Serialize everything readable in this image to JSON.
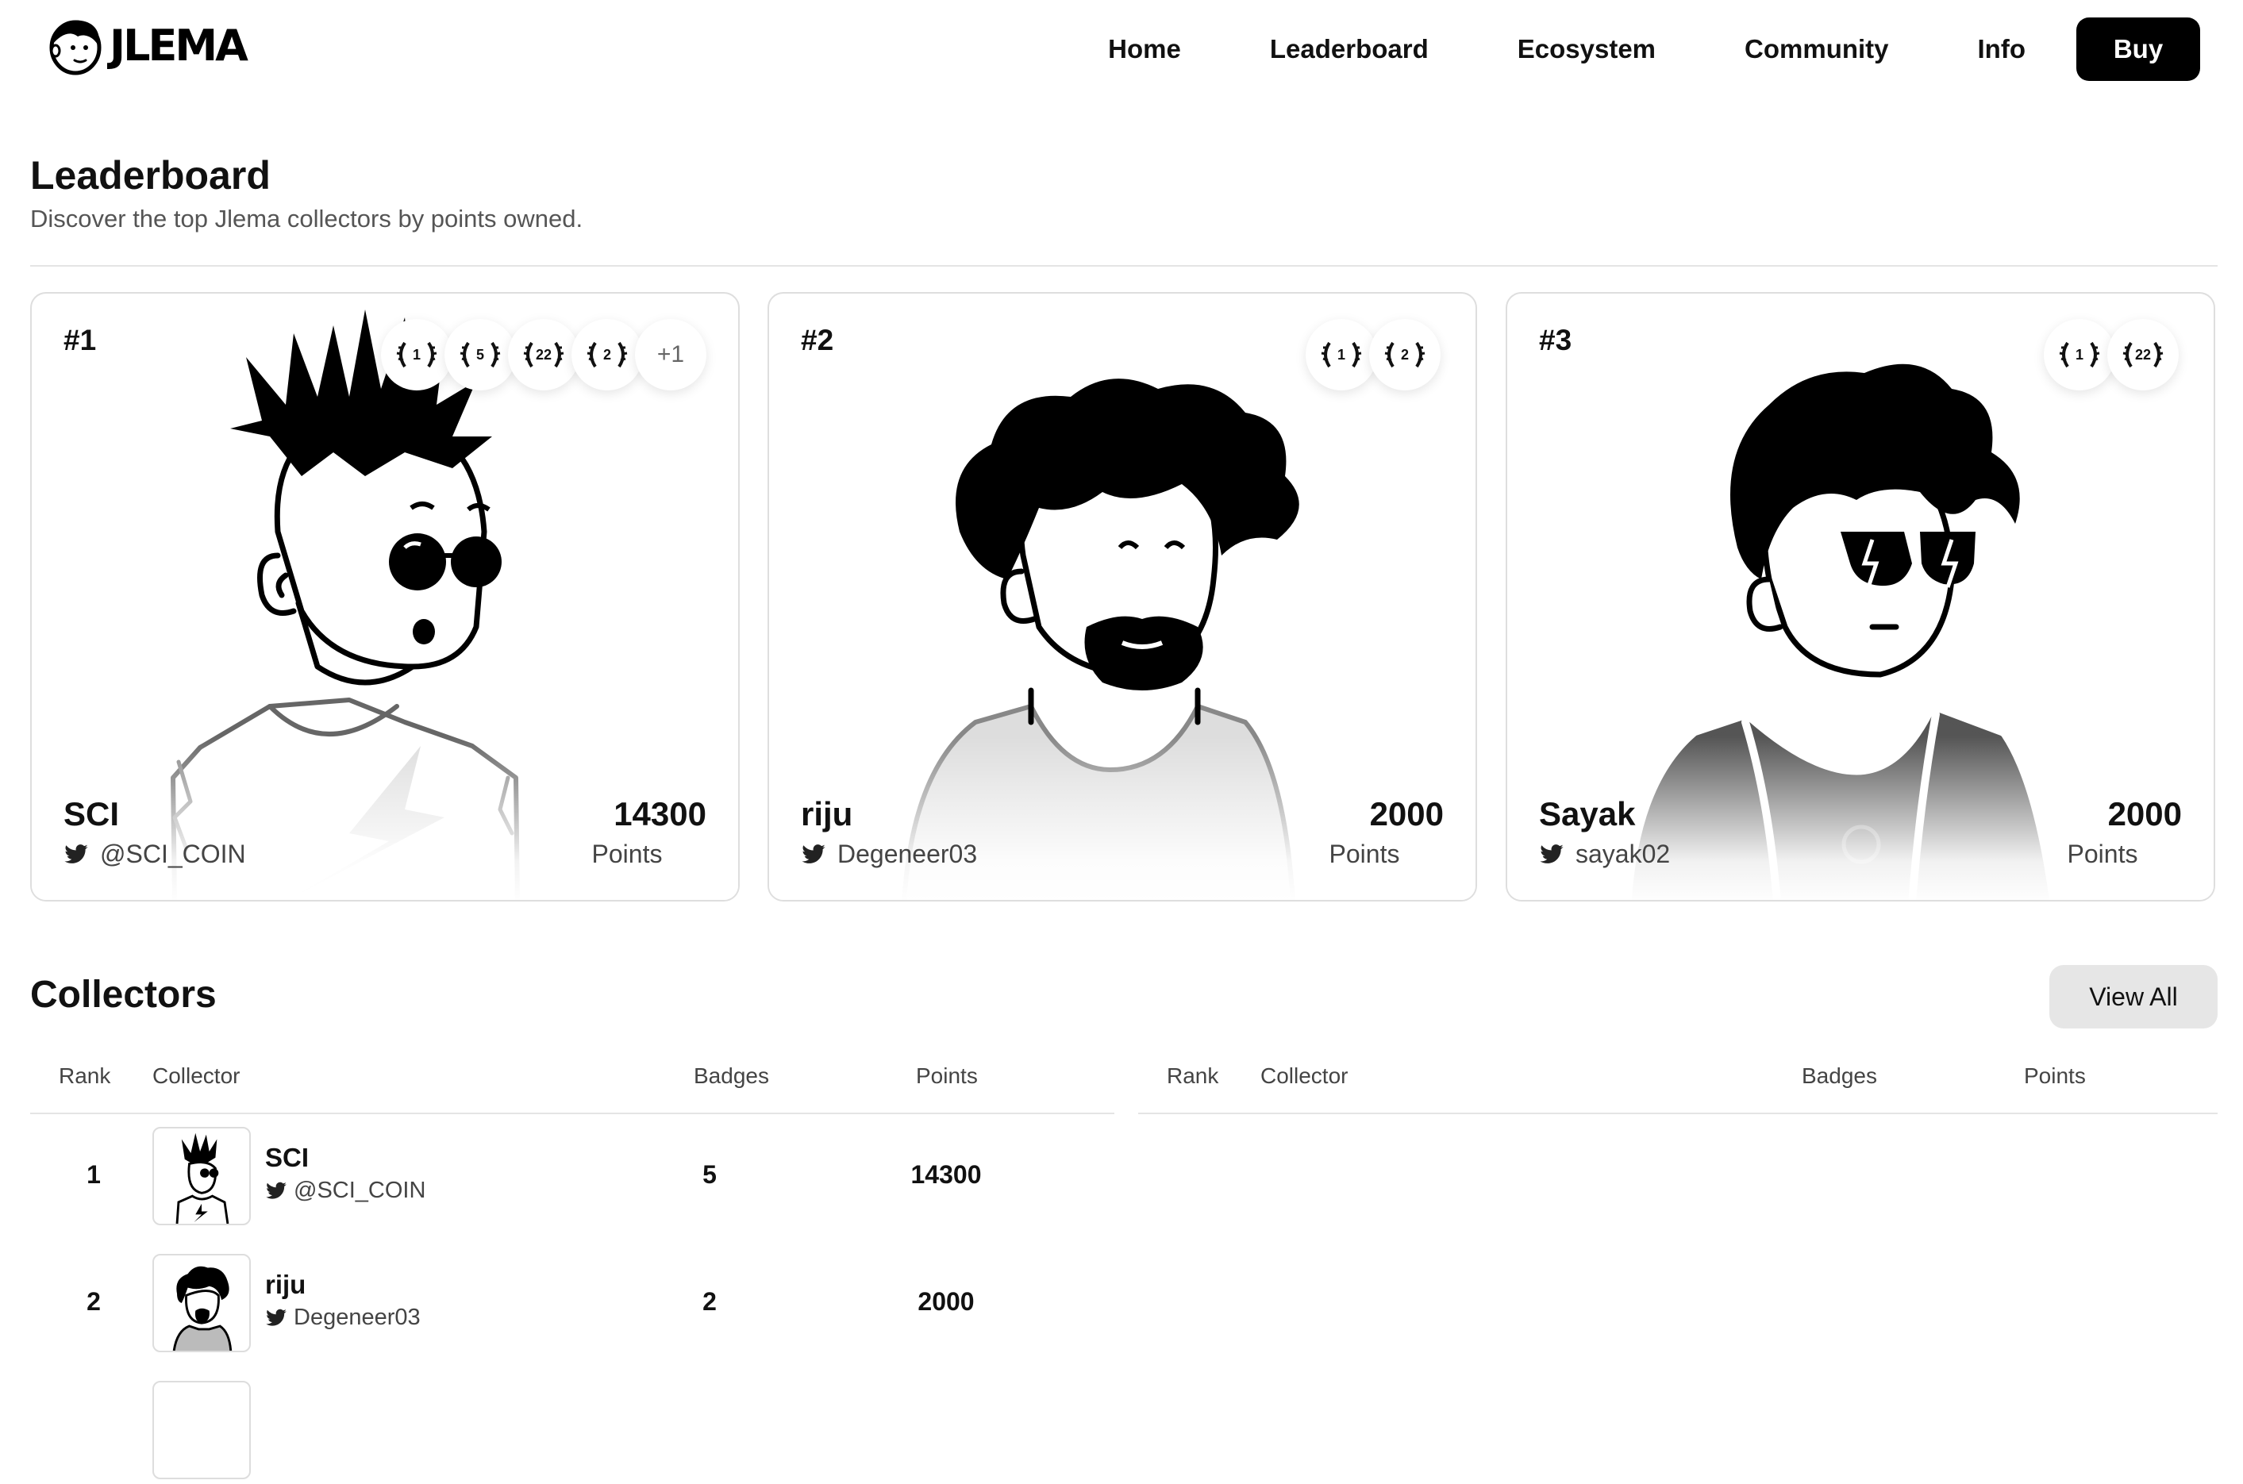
{
  "brand": {
    "name": "JLEMA"
  },
  "nav": {
    "links": [
      "Home",
      "Leaderboard",
      "Ecosystem",
      "Community",
      "Info"
    ],
    "buy_label": "Buy"
  },
  "leaderboard": {
    "title": "Leaderboard",
    "subtitle": "Discover the top Jlema collectors by points owned.",
    "cards": [
      {
        "rank": "#1",
        "name": "SCI",
        "handle": "@SCI_COIN",
        "points": "14300",
        "points_label": "Points",
        "badges": [
          "1",
          "5",
          "22",
          "2"
        ],
        "more_badges": "+1",
        "avatar_icon": "mohawk-sunglasses-avatar"
      },
      {
        "rank": "#2",
        "name": "riju",
        "handle": "Degeneer03",
        "points": "2000",
        "points_label": "Points",
        "badges": [
          "1",
          "2"
        ],
        "avatar_icon": "curly-hair-beard-avatar"
      },
      {
        "rank": "#3",
        "name": "Sayak",
        "handle": "sayak02",
        "points": "2000",
        "points_label": "Points",
        "badges": [
          "1",
          "22"
        ],
        "avatar_icon": "lightning-glasses-avatar"
      }
    ]
  },
  "collectors": {
    "title": "Collectors",
    "view_all_label": "View All",
    "columns": [
      "Rank",
      "Collector",
      "Badges",
      "Points"
    ],
    "rows": [
      {
        "rank": "1",
        "name": "SCI",
        "handle": "@SCI_COIN",
        "badges": "5",
        "points": "14300"
      },
      {
        "rank": "2",
        "name": "riju",
        "handle": "Degeneer03",
        "badges": "2",
        "points": "2000"
      }
    ]
  },
  "colors": {
    "accent": "#000000",
    "border": "#dedede",
    "muted": "#555555",
    "button_bg": "#e6e6e6"
  }
}
